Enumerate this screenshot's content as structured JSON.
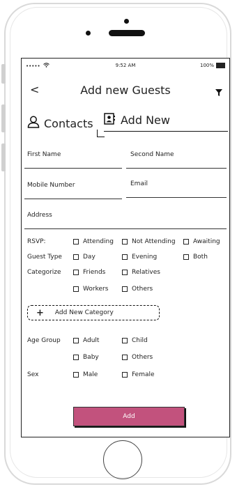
{
  "status": {
    "signal": "•••••",
    "time": "9:52 AM",
    "battery": "100%"
  },
  "header": {
    "back_label": "<",
    "title": "Add new Guests"
  },
  "tabs": {
    "contacts": "Contacts",
    "add_new": "Add New"
  },
  "form": {
    "first_name": "First Name",
    "second_name": "Second Name",
    "mobile": "Mobile Number",
    "email": "Email",
    "address": "Address"
  },
  "rsvp": {
    "label": "RSVP:",
    "options": [
      "Attending",
      "Not Attending",
      "Awaiting"
    ]
  },
  "guest_type": {
    "label": "Guest Type",
    "options": [
      "Day",
      "Evening",
      "Both"
    ]
  },
  "categorize": {
    "label": "Categorize",
    "options": [
      "Friends",
      "Relatives",
      "Workers",
      "Others"
    ]
  },
  "add_category": {
    "label": "Add New Category"
  },
  "age_group": {
    "label": "Age Group",
    "options": [
      "Adult",
      "Child",
      "Baby",
      "Others"
    ]
  },
  "sex": {
    "label": "Sex",
    "options": [
      "Male",
      "Female"
    ]
  },
  "submit": {
    "label": "Add",
    "color": "#c2527d"
  }
}
